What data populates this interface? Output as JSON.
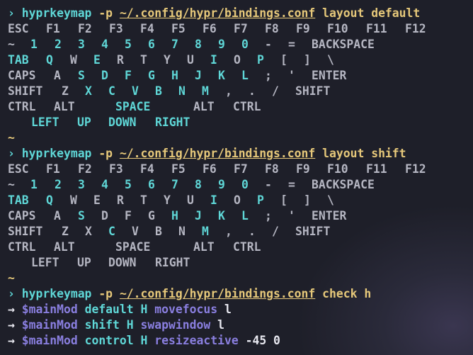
{
  "prompt": {
    "symbol": "›",
    "empty": "~"
  },
  "commands": [
    {
      "cmd": "hyprkeymap",
      "flag": "-p",
      "path": "~/.config/hypr/bindings.conf",
      "args": "layout default"
    },
    {
      "cmd": "hyprkeymap",
      "flag": "-p",
      "path": "~/.config/hypr/bindings.conf",
      "args": "layout shift"
    },
    {
      "cmd": "hyprkeymap",
      "flag": "-p",
      "path": "~/.config/hypr/bindings.conf",
      "args": "check h"
    }
  ],
  "keyboard_rows": [
    [
      "ESC",
      "F1",
      "F2",
      "F3",
      "F4",
      "F5",
      "F6",
      "F7",
      "F8",
      "F9",
      "F10",
      "F11",
      "F12"
    ],
    [
      "~",
      "1",
      "2",
      "3",
      "4",
      "5",
      "6",
      "7",
      "8",
      "9",
      "0",
      "-",
      "=",
      "BACKSPACE"
    ],
    [
      "TAB",
      "Q",
      "W",
      "E",
      "R",
      "T",
      "Y",
      "U",
      "I",
      "O",
      "P",
      "[",
      "]",
      "\\"
    ],
    [
      "CAPS",
      "A",
      "S",
      "D",
      "F",
      "G",
      "H",
      "J",
      "K",
      "L",
      ";",
      "'",
      "ENTER"
    ],
    [
      "SHIFT",
      "Z",
      "X",
      "C",
      "V",
      "B",
      "N",
      "M",
      ",",
      ".",
      "/",
      "SHIFT"
    ],
    [
      "CTRL",
      "ALT",
      "SPACE",
      "ALT",
      "CTRL"
    ],
    [
      "LEFT",
      "UP",
      "DOWN",
      "RIGHT"
    ]
  ],
  "layouts": [
    {
      "name": "default",
      "highlighted": [
        "1",
        "2",
        "3",
        "4",
        "5",
        "6",
        "7",
        "8",
        "9",
        "0",
        "TAB",
        "Q",
        "E",
        "I",
        "P",
        "S",
        "D",
        "F",
        "G",
        "H",
        "J",
        "K",
        "L",
        "X",
        "C",
        "V",
        "B",
        "N",
        "M",
        "SPACE",
        "LEFT",
        "UP",
        "DOWN",
        "RIGHT"
      ]
    },
    {
      "name": "shift",
      "highlighted": [
        "1",
        "2",
        "3",
        "4",
        "5",
        "6",
        "7",
        "8",
        "9",
        "0",
        "TAB",
        "Q",
        "I",
        "P",
        "S",
        "H",
        "J",
        "K",
        "L",
        "C",
        "M"
      ]
    }
  ],
  "bindings": [
    {
      "arrow": "→",
      "var": "$mainMod",
      "mod": "default",
      "key": "H",
      "dispatcher": "movefocus",
      "arg": "l"
    },
    {
      "arrow": "→",
      "var": "$mainMod",
      "mod": "shift",
      "key": "H",
      "dispatcher": "swapwindow",
      "arg": "l"
    },
    {
      "arrow": "→",
      "var": "$mainMod",
      "mod": "control",
      "key": "H",
      "dispatcher": "resizeactive",
      "arg": "-45 0"
    }
  ]
}
